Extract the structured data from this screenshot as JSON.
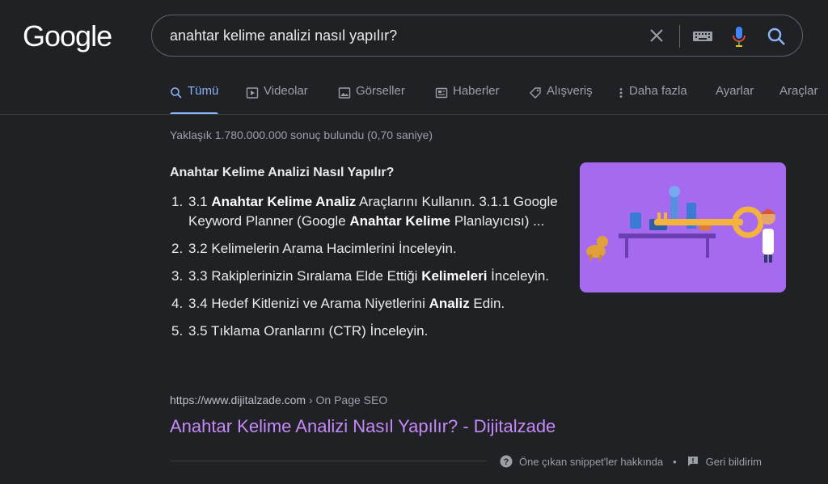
{
  "logo": "Google",
  "search": {
    "query": "anahtar kelime analizi nasıl yapılır?"
  },
  "tabs": [
    {
      "label": "Tümü",
      "icon": "search-icon",
      "active": true
    },
    {
      "label": "Videolar",
      "icon": "video-icon"
    },
    {
      "label": "Görseller",
      "icon": "image-icon"
    },
    {
      "label": "Haberler",
      "icon": "news-icon"
    },
    {
      "label": "Alışveriş",
      "icon": "tag-icon"
    },
    {
      "label": "Daha fazla",
      "icon": "more-vert-icon"
    },
    {
      "label": "Ayarlar"
    },
    {
      "label": "Araçlar"
    }
  ],
  "stats": "Yaklaşık 1.780.000.000 sonuç bulundu (0,70 saniye)",
  "snippet": {
    "title": "Anahtar Kelime Analizi Nasıl Yapılır?",
    "steps": [
      {
        "num": "1.",
        "parts": [
          "3.1 ",
          "Anahtar Kelime Analiz",
          " Araçlarını Kullanın. 3.1.1 Google Keyword Planner (Google ",
          "Anahtar Kelime",
          " Planlayıcısı) ..."
        ]
      },
      {
        "num": "2.",
        "parts": [
          "3.2 Kelimelerin Arama Hacimlerini İnceleyin."
        ]
      },
      {
        "num": "3.",
        "parts": [
          "3.3 Rakiplerinizin Sıralama Elde Ettiği ",
          "Kelimeleri",
          " İnceleyin."
        ]
      },
      {
        "num": "4.",
        "parts": [
          "3.4 Hedef Kitlenizi ve Arama Niyetlerini ",
          "Analiz",
          " Edin."
        ]
      },
      {
        "num": "5.",
        "parts": [
          "3.5 Tıklama Oranlarını (CTR) İnceleyin."
        ]
      }
    ]
  },
  "result": {
    "url": "https://www.dijitalzade.com",
    "breadcrumb": " › On Page SEO",
    "title": "Anahtar Kelime Analizi Nasıl Yapılır? - Dijitalzade"
  },
  "footer": {
    "about": "Öne çıkan snippet'ler hakkında",
    "separator": "•",
    "feedback": "Geri bildirim"
  },
  "colors": {
    "accent": "#8ab4f8",
    "link_visited": "#c58af9",
    "thumb_bg": "#a66af0"
  }
}
